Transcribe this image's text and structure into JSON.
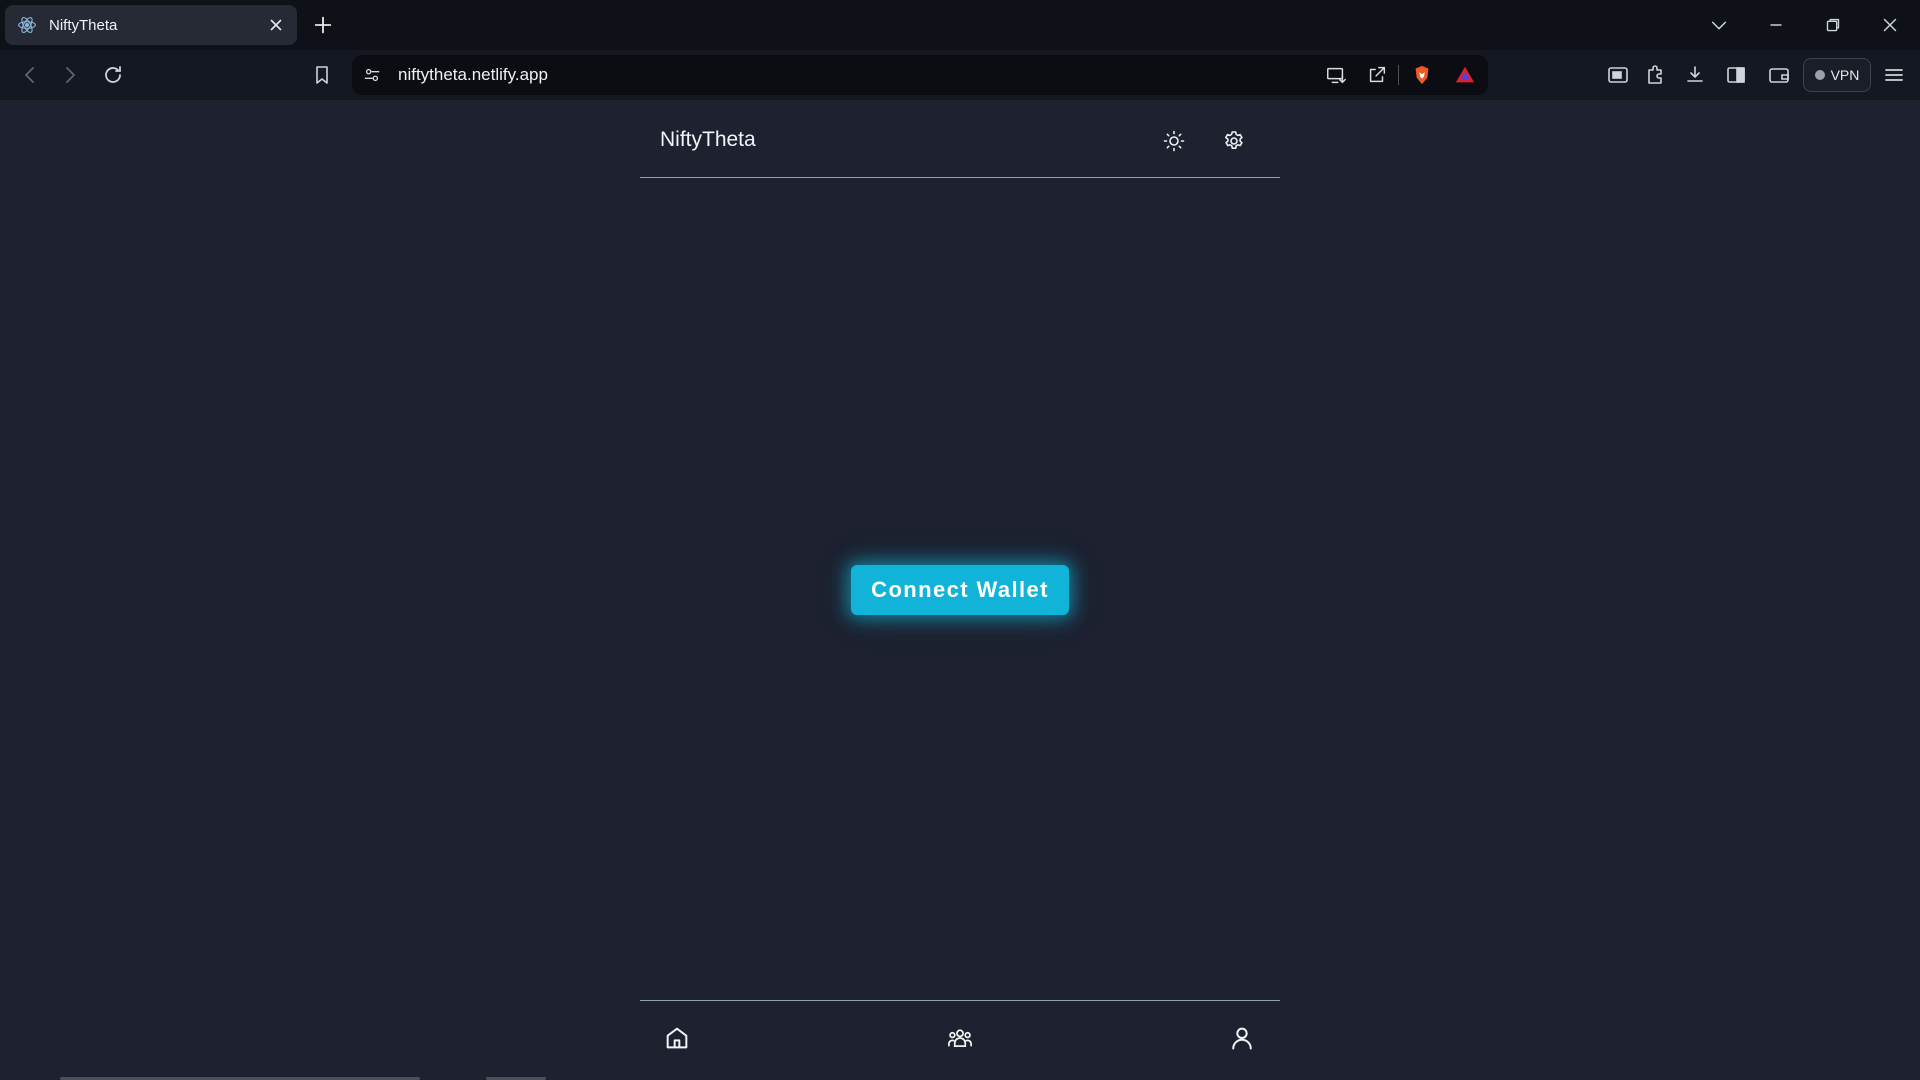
{
  "browser": {
    "tab": {
      "title": "NiftyTheta"
    },
    "url": "niftytheta.netlify.app",
    "vpn_label": "VPN"
  },
  "app": {
    "title": "NiftyTheta",
    "connect_label": "Connect Wallet",
    "accent_color": "#11b3d9",
    "background_color": "#1d2130"
  },
  "icons": {
    "header": [
      "sun-icon",
      "gear-icon"
    ],
    "bottom_nav": [
      "home-icon",
      "community-icon",
      "user-icon"
    ]
  }
}
